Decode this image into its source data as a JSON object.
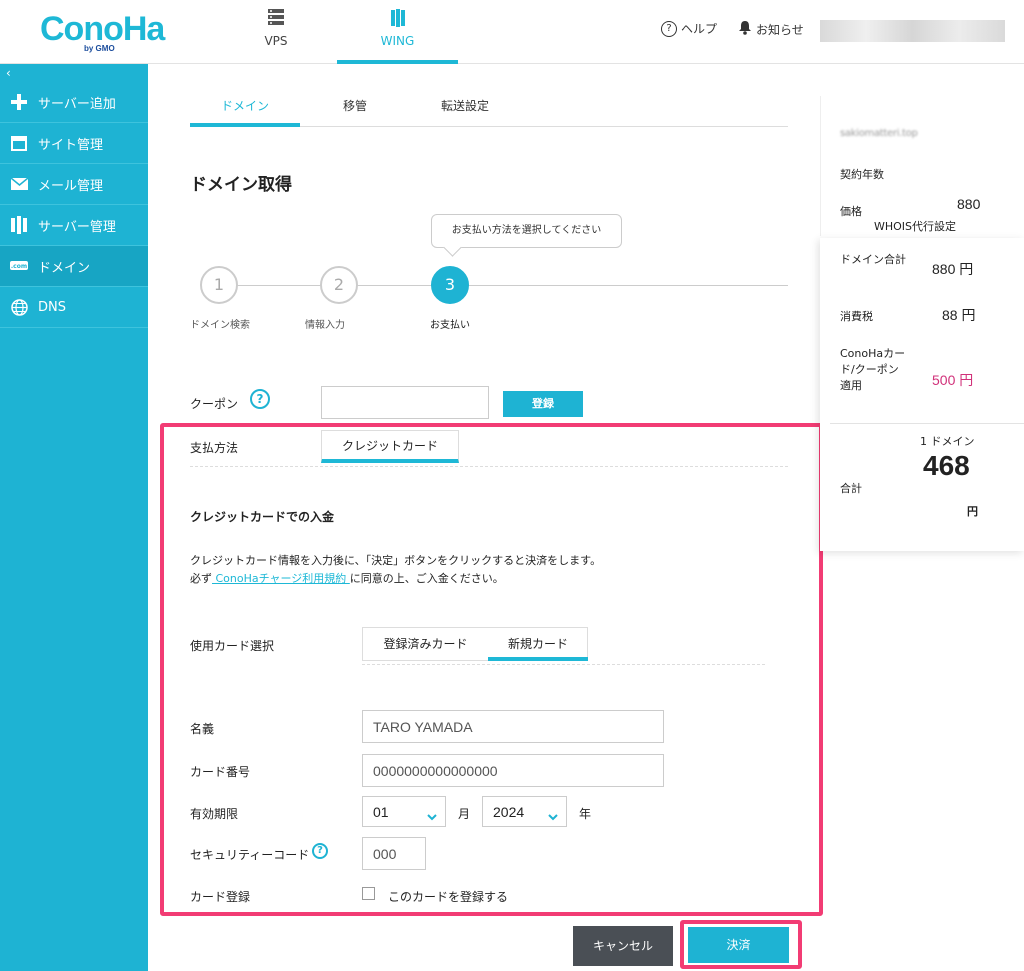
{
  "header": {
    "logo_text": "ConoHa",
    "logo_sub": "by GMO",
    "tabs": [
      {
        "label": "VPS",
        "icon": "server-icon"
      },
      {
        "label": "WING",
        "icon": "wing-icon"
      }
    ],
    "help_label": "ヘルプ",
    "notice_label": "お知らせ"
  },
  "sidebar": {
    "collapse": "‹",
    "items": [
      {
        "label": "サーバー追加",
        "icon": "plus-icon"
      },
      {
        "label": "サイト管理",
        "icon": "window-icon"
      },
      {
        "label": "メール管理",
        "icon": "mail-icon"
      },
      {
        "label": "サーバー管理",
        "icon": "server-manage-icon"
      },
      {
        "label": "ドメイン",
        "icon": "domain-icon"
      },
      {
        "label": "DNS",
        "icon": "globe-icon"
      }
    ]
  },
  "subtabs": [
    "ドメイン",
    "移管",
    "転送設定"
  ],
  "page_title": "ドメイン取得",
  "steps": {
    "tooltip": "お支払い方法を選択してください",
    "items": [
      {
        "num": "1",
        "label": "ドメイン検索"
      },
      {
        "num": "2",
        "label": "情報入力"
      },
      {
        "num": "3",
        "label": "お支払い"
      }
    ]
  },
  "coupon": {
    "label": "クーポン",
    "help": "?",
    "value": "",
    "button": "登録"
  },
  "payment": {
    "label": "支払方法",
    "tab": "クレジットカード",
    "section_title": "クレジットカードでの入金",
    "desc_line1": "クレジットカード情報を入力後に、「決定」ボタンをクリックすると決済をします。",
    "desc_line2_pre": "必ず",
    "desc_link": " ConoHaチャージ利用規約 ",
    "desc_line2_post": "に同意の上、ご入金ください。",
    "card_select_label": "使用カード選択",
    "card_tabs": [
      "登録済みカード",
      "新規カード"
    ],
    "name_label": "名義",
    "name_placeholder": "TARO YAMADA",
    "number_label": "カード番号",
    "number_placeholder": "0000000000000000",
    "expiry_label": "有効期限",
    "expiry_month": "01",
    "month_unit": "月",
    "expiry_year": "2024",
    "year_unit": "年",
    "cvc_label": "セキュリティーコード",
    "cvc_help": "?",
    "cvc_placeholder": "000",
    "register_label": "カード登録",
    "register_checkbox_label": "このカードを登録する"
  },
  "actions": {
    "cancel": "キャンセル",
    "submit": "決済"
  },
  "summary": {
    "domain_name": "sakiomatteri.top",
    "contract_years_label": "契約年数",
    "price_label": "価格",
    "price_value": "880",
    "whois_label": "WHOIS代行設定",
    "domain_total_label": "ドメイン合計",
    "domain_total_value": "880 円",
    "tax_label": "消費税",
    "tax_value": "88 円",
    "coupon_label": "ConoHaカード/クーポン適用",
    "coupon_value": "500 円",
    "count_label": "1 ドメイン",
    "total_label": "合計",
    "total_value": "468",
    "total_unit": "円"
  },
  "colors": {
    "accent": "#1eb3d3",
    "highlight": "#f23c74",
    "coupon_value": "#d1317a"
  }
}
